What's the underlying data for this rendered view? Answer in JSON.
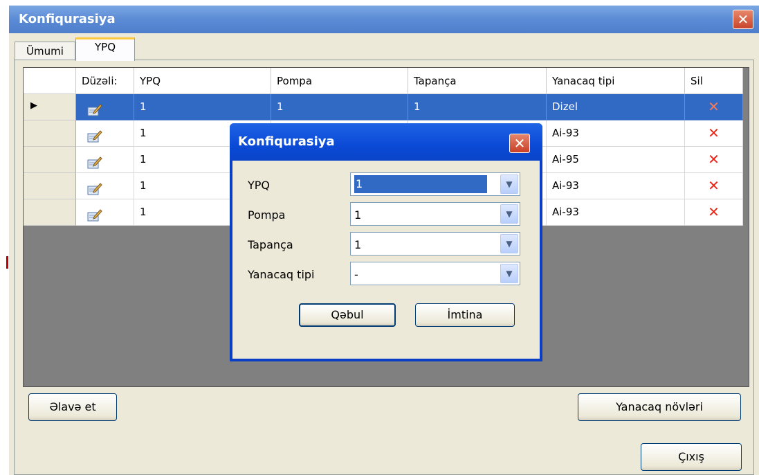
{
  "window": {
    "title": "Konfiqurasiya",
    "close_glyph": "✕"
  },
  "tabs": [
    {
      "label": "Ümumi"
    },
    {
      "label": "YPQ"
    }
  ],
  "grid": {
    "columns": [
      "Düzəli:",
      "YPQ",
      "Pompa",
      "Tapança",
      "Yanacaq tipi",
      "Sil"
    ],
    "rows": [
      {
        "ypq": "1",
        "pompa": "1",
        "tapanca": "1",
        "yanacaq": "Dizel",
        "delete": "✕",
        "selected": true
      },
      {
        "ypq": "1",
        "pompa": "",
        "tapanca": "",
        "yanacaq": "Ai-93",
        "delete": "✕"
      },
      {
        "ypq": "1",
        "pompa": "",
        "tapanca": "",
        "yanacaq": "Ai-95",
        "delete": "✕"
      },
      {
        "ypq": "1",
        "pompa": "",
        "tapanca": "",
        "yanacaq": "Ai-93",
        "delete": "✕"
      },
      {
        "ypq": "1",
        "pompa": "",
        "tapanca": "",
        "yanacaq": "Ai-93",
        "delete": "✕"
      }
    ],
    "current_row_marker": "▶"
  },
  "buttons": {
    "add": "Əlavə et",
    "fuel_types": "Yanacaq növləri",
    "exit": "Çıxış"
  },
  "dialog": {
    "title": "Konfiqurasiya",
    "close_glyph": "✕",
    "fields": [
      {
        "label": "YPQ",
        "value": "1"
      },
      {
        "label": "Pompa",
        "value": "1"
      },
      {
        "label": "Tapança",
        "value": "1"
      },
      {
        "label": "Yanacaq tipi",
        "value": "-"
      }
    ],
    "ok": "Qəbul",
    "cancel": "İmtina",
    "arrow_glyph": "▼"
  },
  "colors": {
    "selection": "#316ac5",
    "title_bar": "#5b8bd5",
    "dialog_title": "#0b4ad6",
    "delete": "#e8271c"
  }
}
